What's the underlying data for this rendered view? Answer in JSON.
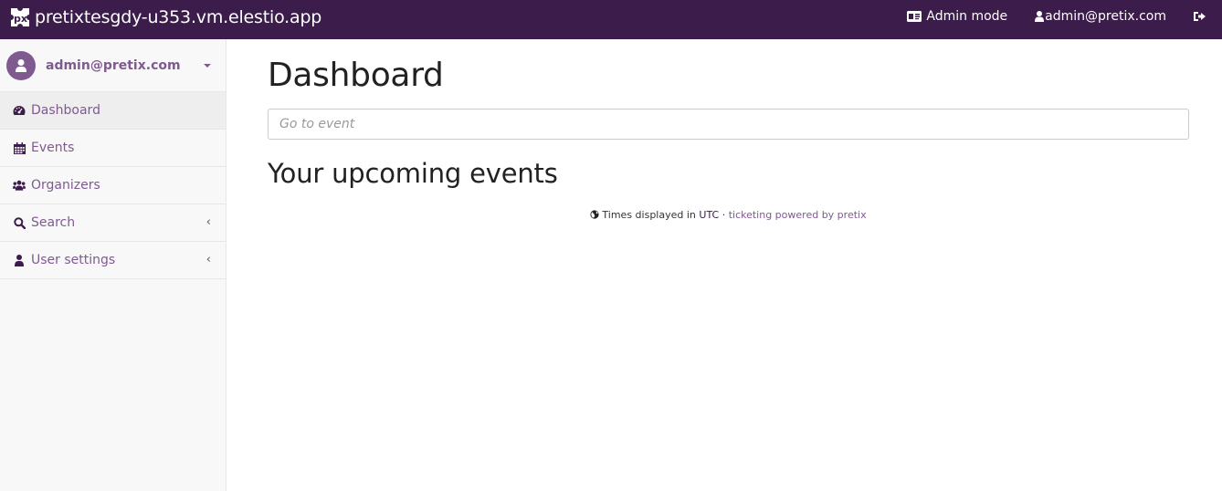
{
  "topbar": {
    "site_title": "pretixtesgdy-u353.vm.elestio.app",
    "admin_mode_label": "Admin mode",
    "user_email": "admin@pretix.com"
  },
  "sidebar": {
    "user_name": "admin@pretix.com",
    "items": [
      {
        "label": "Dashboard",
        "icon": "dashboard-icon",
        "active": true
      },
      {
        "label": "Events",
        "icon": "calendar-icon"
      },
      {
        "label": "Organizers",
        "icon": "users-icon"
      },
      {
        "label": "Search",
        "icon": "search-icon",
        "expandable": true
      },
      {
        "label": "User settings",
        "icon": "user-icon",
        "expandable": true
      }
    ]
  },
  "main": {
    "title": "Dashboard",
    "search_placeholder": "Go to event",
    "upcoming_title": "Your upcoming events"
  },
  "footer": {
    "times_text": "Times displayed in",
    "timezone": "UTC",
    "separator": "·",
    "powered_text": "ticketing powered by pretix"
  },
  "colors": {
    "topbar_bg": "#3b1c4a",
    "accent": "#7f5a91",
    "sidebar_bg": "#f8f8f8"
  }
}
